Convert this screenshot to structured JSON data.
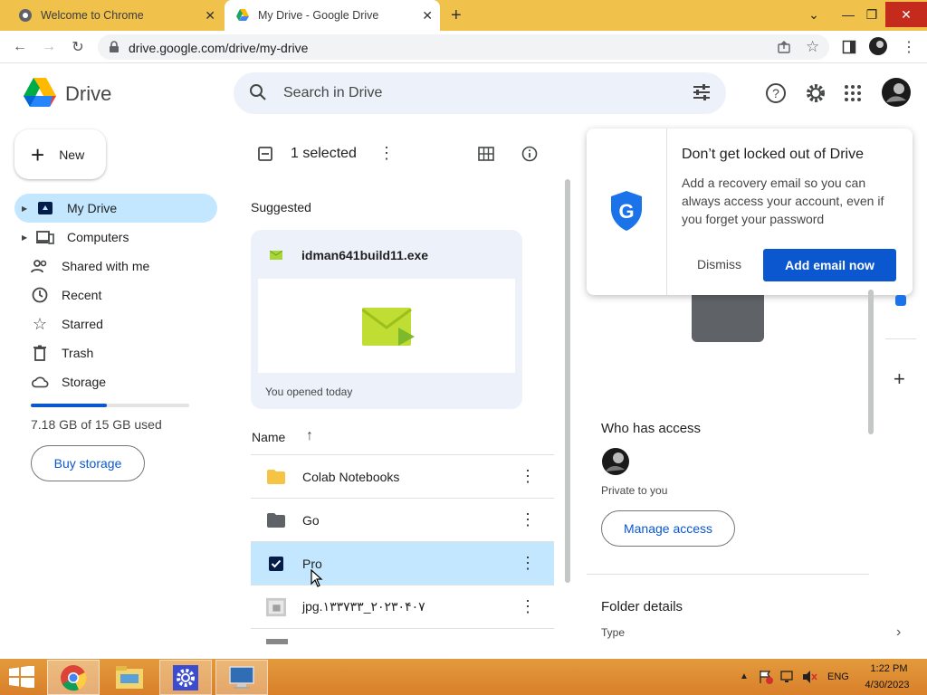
{
  "browser": {
    "tabs": [
      {
        "title": "Welcome to Chrome"
      },
      {
        "title": "My Drive - Google Drive"
      }
    ],
    "url": "drive.google.com/drive/my-drive"
  },
  "drive": {
    "app_name": "Drive",
    "search_placeholder": "Search in Drive",
    "new_label": "New",
    "nav": [
      {
        "label": "My Drive",
        "icon": "my-drive-icon"
      },
      {
        "label": "Computers",
        "icon": "computers-icon"
      },
      {
        "label": "Shared with me",
        "icon": "shared-icon"
      },
      {
        "label": "Recent",
        "icon": "clock-icon"
      },
      {
        "label": "Starred",
        "icon": "star-icon"
      },
      {
        "label": "Trash",
        "icon": "trash-icon"
      },
      {
        "label": "Storage",
        "icon": "cloud-icon"
      }
    ],
    "storage": {
      "used_text": "7.18 GB of 15 GB used",
      "fraction": 0.479
    },
    "buy_storage": "Buy storage",
    "selection": {
      "count_label": "1 selected"
    },
    "suggested": {
      "heading": "Suggested",
      "file_name": "idman641build11.exe",
      "subtitle": "You opened today"
    },
    "list": {
      "column_name": "Name",
      "rows": [
        {
          "name": "Colab Notebooks",
          "type": "folder-yellow",
          "selected": false
        },
        {
          "name": "Go",
          "type": "folder-grey",
          "selected": false
        },
        {
          "name": "Pro",
          "type": "folder",
          "selected": true
        },
        {
          "name": "jpg.۱۳۳۷۳۳_۲۰۲۳۰۴۰۷",
          "type": "image",
          "selected": false
        }
      ]
    },
    "popup": {
      "title": "Don’t get locked out of Drive",
      "body": "Add a recovery email so you can always access your account, even if you forget your password",
      "dismiss": "Dismiss",
      "primary": "Add email now"
    },
    "details": {
      "who_has_access": "Who has access",
      "privacy": "Private to you",
      "manage_access": "Manage access",
      "folder_details": "Folder details",
      "type_label": "Type"
    }
  },
  "taskbar": {
    "language": "ENG",
    "time": "1:22 PM",
    "date": "4/30/2023"
  },
  "colors": {
    "accent": "#0b57d0",
    "selected_bg": "#c2e7ff",
    "tabstrip": "#f0c24b"
  }
}
